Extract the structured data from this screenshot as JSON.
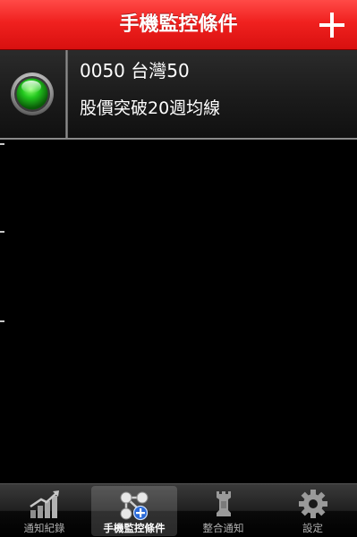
{
  "navbar": {
    "title": "手機監控條件",
    "add_icon": "plus-icon"
  },
  "conditions": [
    {
      "stock": "0050 台灣50",
      "description": "股價突破20週均線",
      "status_icon": "green-light-icon",
      "status_color": "#1fbf1f"
    }
  ],
  "tabs": [
    {
      "label": "通知紀錄",
      "icon": "chart-growth-icon",
      "selected": false
    },
    {
      "label": "手機監控條件",
      "icon": "network-add-icon",
      "selected": true
    },
    {
      "label": "整合通知",
      "icon": "rook-tower-icon",
      "selected": false
    },
    {
      "label": "設定",
      "icon": "gear-icon",
      "selected": false
    }
  ],
  "colors": {
    "navbar_red": "#e8201e",
    "tab_icon_gray": "#9a9a9a",
    "tab_icon_blue": "#2a6ad8"
  }
}
